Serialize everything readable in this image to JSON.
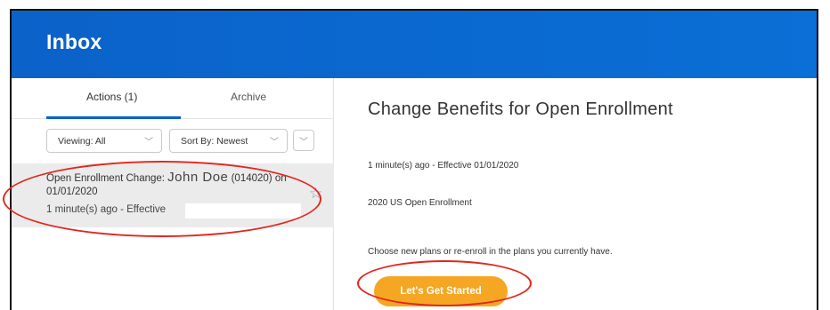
{
  "header": {
    "title": "Inbox"
  },
  "tabs": {
    "actions": "Actions (1)",
    "archive": "Archive"
  },
  "filters": {
    "viewing": "Viewing: All",
    "sort": "Sort By: Newest",
    "chevron": "﹀"
  },
  "inbox_item": {
    "title_prefix": "Open Enrollment Change:",
    "name": "John Doe",
    "title_suffix": "(014020) on 01/01/2020",
    "meta": "1 minute(s) ago - Effective",
    "star": "☆"
  },
  "detail": {
    "title": "Change Benefits for Open Enrollment",
    "meta": "1 minute(s) ago -  Effective 01/01/2020",
    "plan": "2020 US Open Enrollment",
    "note": "Choose new plans or re-enroll in the plans you currently have.",
    "cta_label": "Let's Get Started"
  },
  "colors": {
    "header_bg": "#0b62c9",
    "cta_bg": "#f5a623",
    "annotation": "#e2261d",
    "selected_bg": "#ebebeb"
  }
}
